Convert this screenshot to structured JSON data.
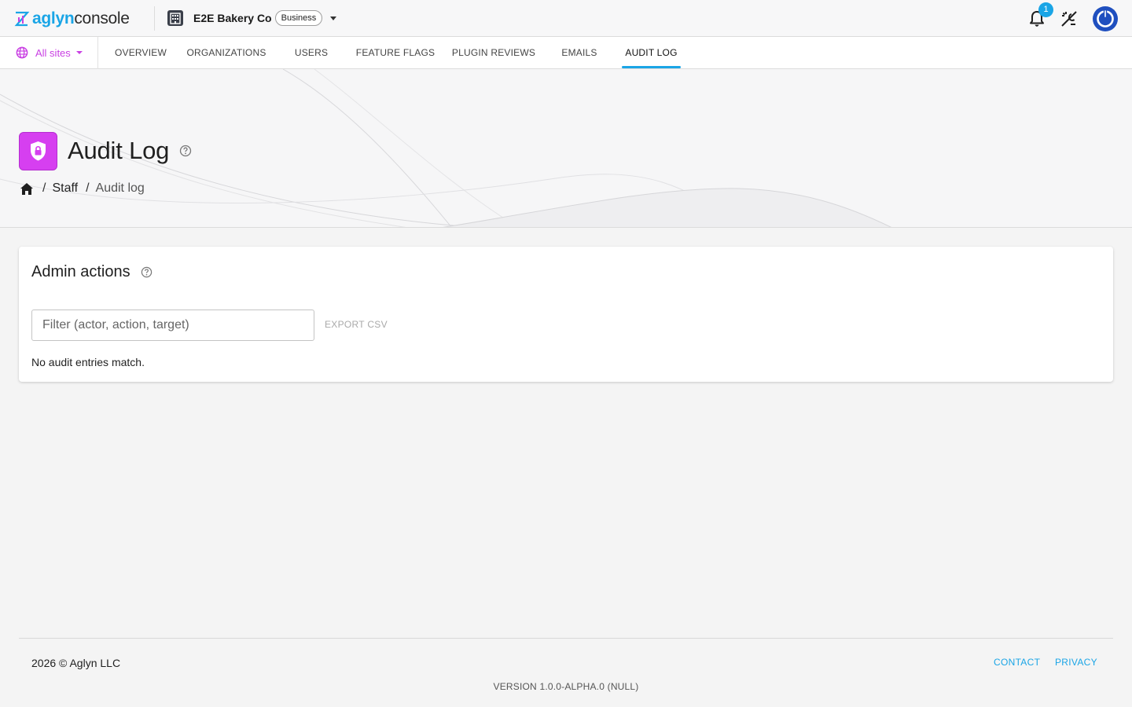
{
  "app": {
    "brand_part1": "aglyn",
    "brand_part2": "console",
    "accent_color": "#1aa5e6",
    "magenta_color": "#c940e3"
  },
  "org": {
    "name": "E2E Bakery Co",
    "plan": "Business",
    "icon": "building-icon"
  },
  "header": {
    "notifications_count": "1",
    "icons": [
      "bell-icon",
      "theme-toggle-icon",
      "power-icon"
    ]
  },
  "nav": {
    "site_selector": "All sites",
    "tabs": [
      {
        "label": "OVERVIEW"
      },
      {
        "label": "ORGANIZATIONS"
      },
      {
        "label": "USERS"
      },
      {
        "label": "FEATURE FLAGS"
      },
      {
        "label": "PLUGIN REVIEWS"
      },
      {
        "label": "EMAILS"
      },
      {
        "label": "AUDIT LOG",
        "active": true
      }
    ]
  },
  "page": {
    "title": "Audit Log",
    "icon": "shield-lock-icon",
    "breadcrumb": [
      "Staff",
      "Audit log"
    ]
  },
  "card": {
    "title": "Admin actions",
    "filter_placeholder": "Filter (actor, action, target)",
    "filter_value": "",
    "export_label": "EXPORT CSV",
    "empty_message": "No audit entries match."
  },
  "footer": {
    "copyright": "2026 © Aglyn LLC",
    "links": [
      "CONTACT",
      "PRIVACY"
    ],
    "version": "VERSION 1.0.0-ALPHA.0 (NULL)"
  }
}
